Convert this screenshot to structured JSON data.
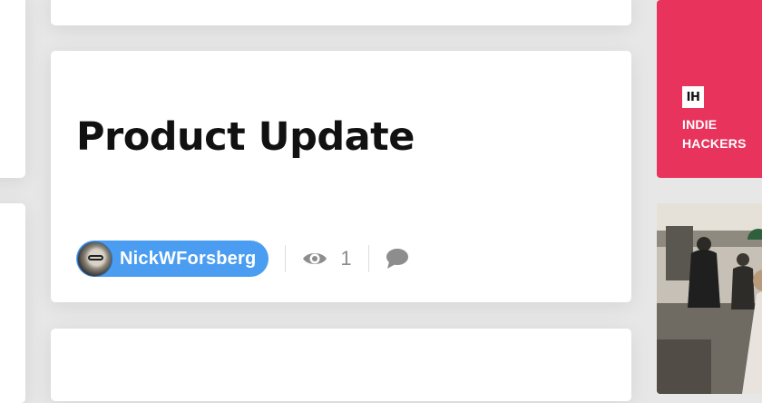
{
  "post": {
    "title": "Product Update",
    "author": "NickWForsberg",
    "views": "1"
  },
  "sidebar": {
    "brand_logo": "IH",
    "brand_line1": "INDIE",
    "brand_line2": "HACKERS",
    "brand_color": "#e8335c"
  },
  "icons": {
    "views": "eye-icon",
    "comments": "speech-bubble-icon"
  }
}
